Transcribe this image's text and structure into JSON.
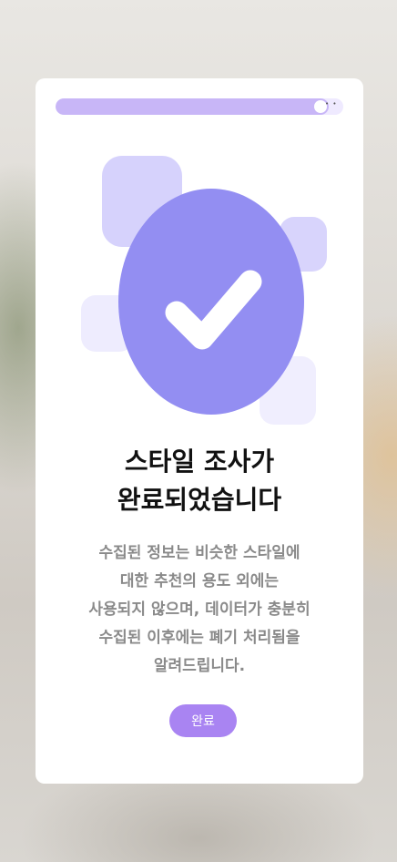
{
  "progress": {
    "fraction": 0.95,
    "more_indicator": "• •"
  },
  "title": {
    "line1": "스타일 조사가",
    "line2": "완료되었습니다"
  },
  "description": {
    "lines": [
      "수집된 정보는 비슷한 스타일에",
      "대한 추천의 용도 외에는",
      "사용되지 않으며, 데이터가 충분히",
      "수집된 이후에는 폐기 처리됨을",
      "알려드립니다."
    ]
  },
  "done_button": {
    "label": "완료"
  },
  "colors": {
    "accent": "#a984f2",
    "badge": "#938ef2",
    "progress": "#c8b6f7",
    "card": "#ffffff"
  },
  "icons": {
    "badge": "checkmark-icon"
  }
}
